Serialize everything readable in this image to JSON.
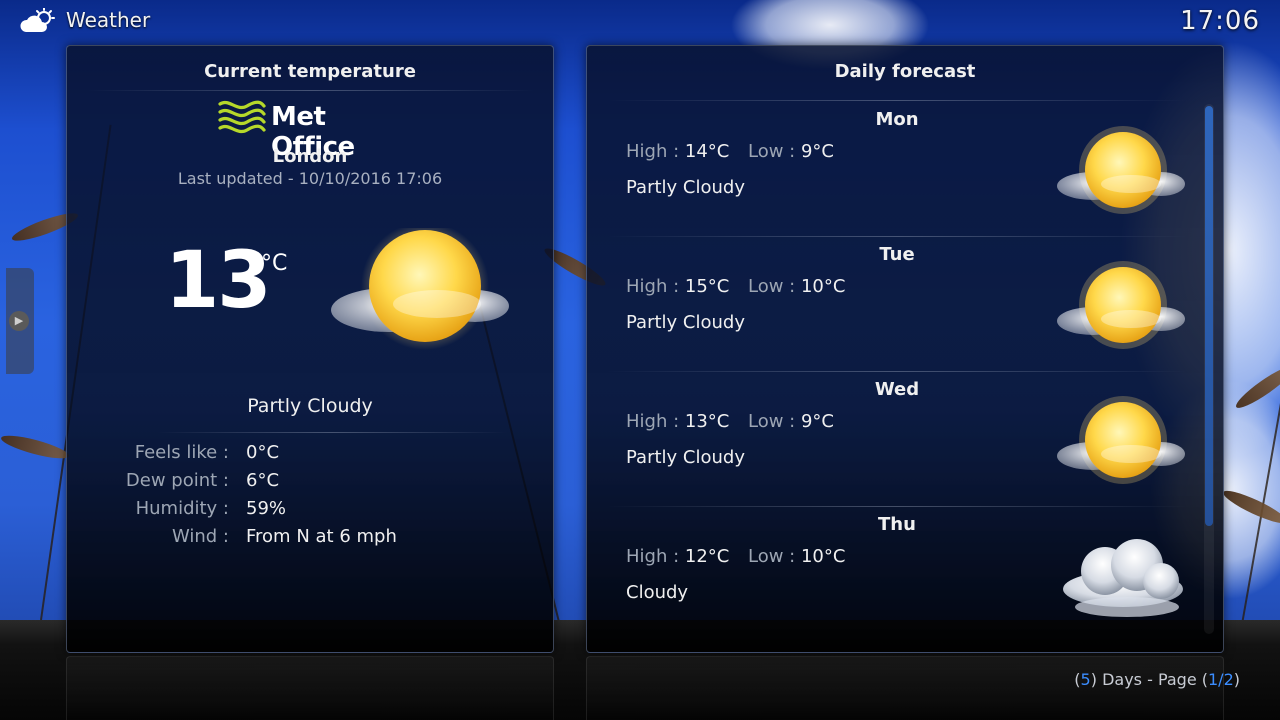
{
  "app": {
    "title": "Weather",
    "clock": "17:06",
    "app_icon": "weather-cloud-sun-icon"
  },
  "current": {
    "heading": "Current temperature",
    "provider": "Met Office",
    "location": "London",
    "last_updated": "Last updated - 10/10/2016 17:06",
    "temperature": "13",
    "unit": "°C",
    "condition": "Partly Cloudy",
    "icon": "partly-cloudy-icon",
    "details": [
      {
        "label": "Feels like :",
        "value": "0°C"
      },
      {
        "label": "Dew point :",
        "value": "6°C"
      },
      {
        "label": "Humidity :",
        "value": "59%"
      },
      {
        "label": "Wind :",
        "value": "From N at 6 mph"
      }
    ]
  },
  "forecast": {
    "heading": "Daily forecast",
    "high_label": "High :",
    "low_label": "Low :",
    "days": [
      {
        "name": "Mon",
        "high": "14°C",
        "low": "9°C",
        "condition": "Partly Cloudy",
        "icon": "partly-cloudy-icon"
      },
      {
        "name": "Tue",
        "high": "15°C",
        "low": "10°C",
        "condition": "Partly Cloudy",
        "icon": "partly-cloudy-icon"
      },
      {
        "name": "Wed",
        "high": "13°C",
        "low": "9°C",
        "condition": "Partly Cloudy",
        "icon": "partly-cloudy-icon"
      },
      {
        "name": "Thu",
        "high": "12°C",
        "low": "10°C",
        "condition": "Cloudy",
        "icon": "cloudy-icon"
      }
    ]
  },
  "paging": {
    "open1": "(",
    "days": "5",
    "mid": ") Days - Page (",
    "page": "1/2",
    "close": ")"
  },
  "colors": {
    "accent": "#3b8dff",
    "label": "#9da6b4",
    "panel_border": "#8296be"
  }
}
